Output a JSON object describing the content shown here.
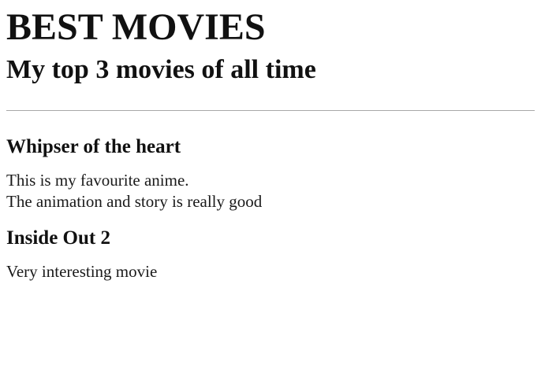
{
  "page": {
    "heading": "BEST MOVIES",
    "subheading": "My top 3 movies of all time"
  },
  "movies": [
    {
      "title": "Whipser of the heart",
      "lines": [
        "This is my favourite anime.",
        "The animation and story is really good"
      ]
    },
    {
      "title": "Inside Out 2",
      "lines": [
        "Very interesting movie"
      ]
    }
  ]
}
